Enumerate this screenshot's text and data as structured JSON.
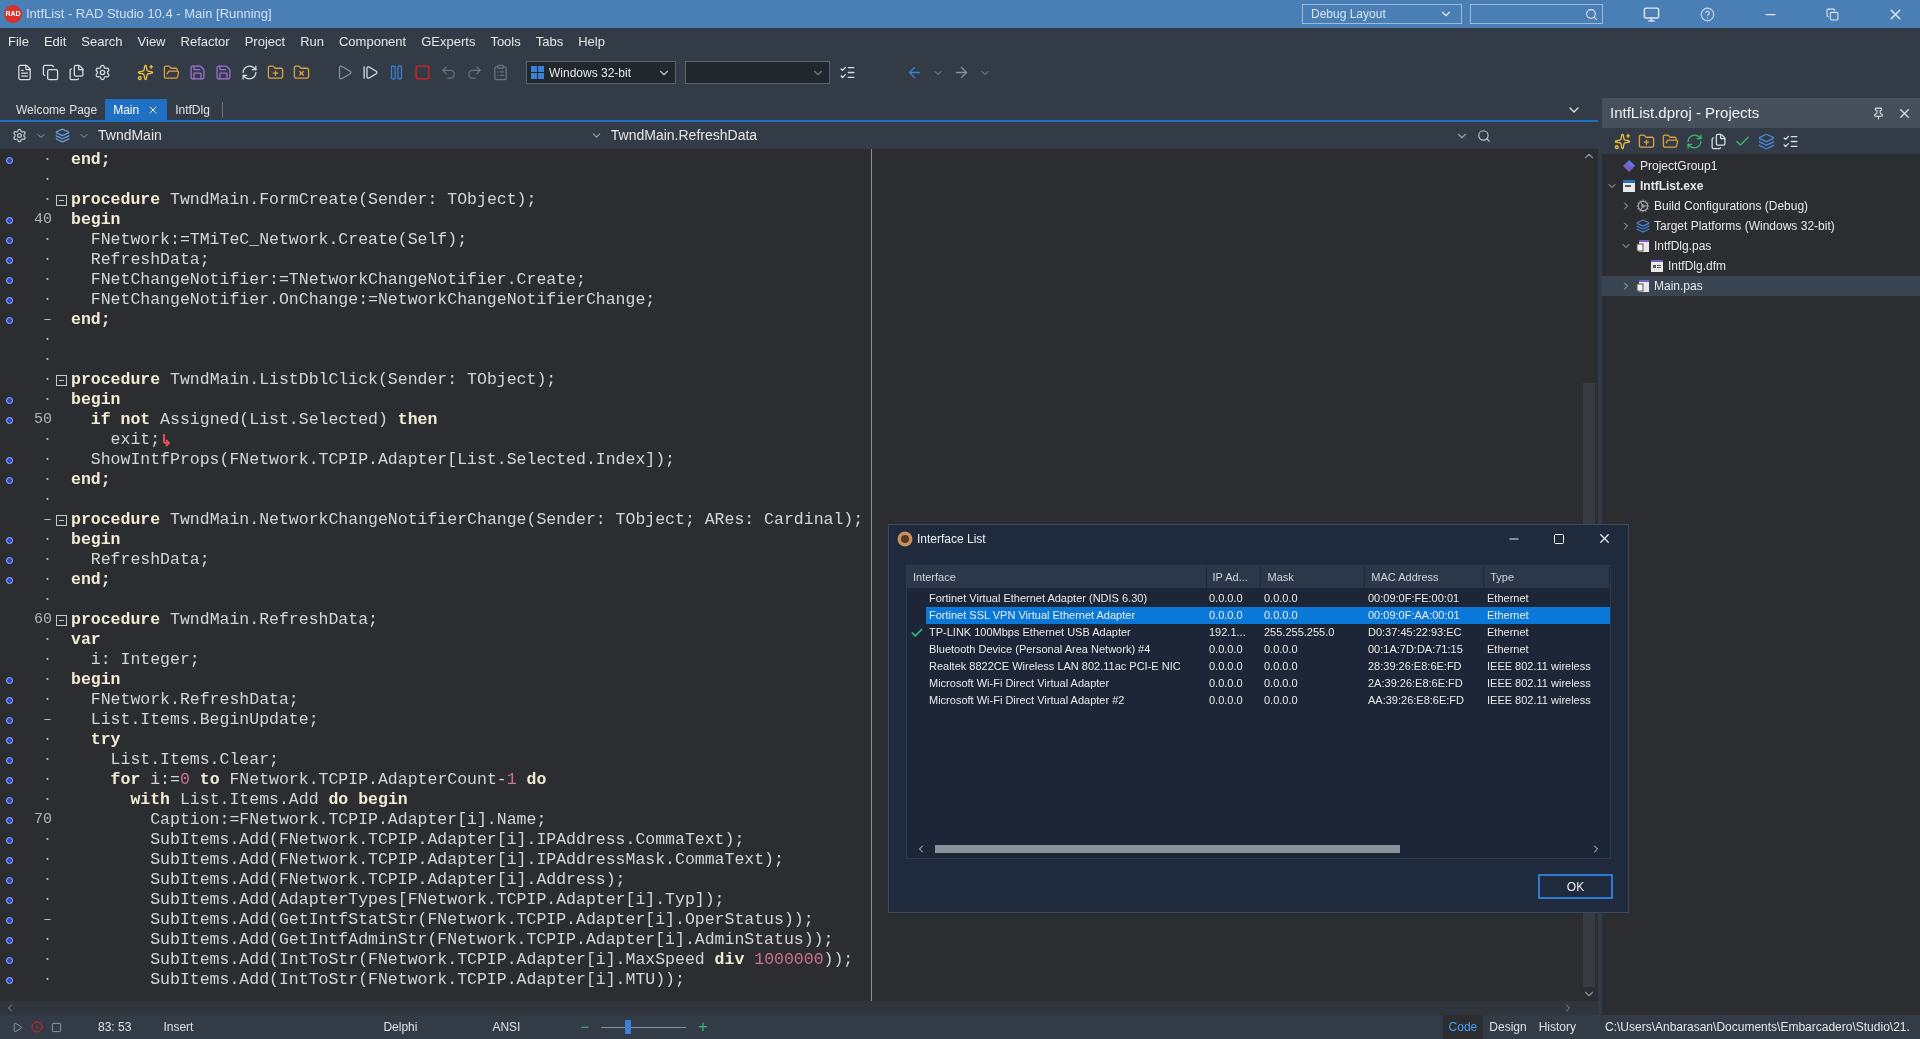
{
  "title_bar": {
    "logo": "RAD",
    "title": "IntfList - RAD Studio 10.4 - Main [Running]",
    "layout": "Debug Layout"
  },
  "menu": [
    "File",
    "Edit",
    "Search",
    "View",
    "Refactor",
    "Project",
    "Run",
    "Component",
    "GExperts",
    "Tools",
    "Tabs",
    "Help"
  ],
  "toolbar": {
    "platform": "Windows 32-bit"
  },
  "editor_tabs": [
    {
      "label": "Welcome Page",
      "selected": false
    },
    {
      "label": "Main",
      "selected": true
    },
    {
      "label": "IntfDlg",
      "selected": false
    }
  ],
  "editor_header": {
    "class": "TwndMain",
    "method": "TwndMain.RefreshData"
  },
  "code_lines": [
    {
      "gutter": "·",
      "marked": true,
      "segments": [
        {
          "text": "end;",
          "kind": "keyword"
        }
      ]
    },
    {
      "gutter": "·",
      "marked": false
    },
    {
      "gutter": "·",
      "marked": false,
      "fold": true,
      "segments": [
        {
          "text": "procedure",
          "kind": "keyword"
        },
        {
          "text": " TwndMain.FormCreate(Sender: TObject);",
          "kind": "plain"
        }
      ]
    },
    {
      "gutter": "40",
      "marked": true,
      "segments": [
        {
          "text": "begin",
          "kind": "keyword"
        }
      ]
    },
    {
      "gutter": "·",
      "marked": true,
      "segments": [
        {
          "text": "  FNetwork:=TMiTeC_Network.Create(Self);",
          "kind": "plain"
        }
      ]
    },
    {
      "gutter": "·",
      "marked": true,
      "segments": [
        {
          "text": "  RefreshData;",
          "kind": "plain"
        }
      ]
    },
    {
      "gutter": "·",
      "marked": true,
      "segments": [
        {
          "text": "  FNetChangeNotifier:=TNetworkChangeNotifier.Create;",
          "kind": "plain"
        }
      ]
    },
    {
      "gutter": "·",
      "marked": true,
      "segments": [
        {
          "text": "  FNetChangeNotifier.OnChange:=NetworkChangeNotifierChange;",
          "kind": "plain"
        }
      ]
    },
    {
      "gutter": "–",
      "marked": true,
      "segments": [
        {
          "text": "end;",
          "kind": "keyword"
        }
      ]
    },
    {
      "gutter": "·",
      "marked": false
    },
    {
      "gutter": "·",
      "marked": false
    },
    {
      "gutter": "·",
      "marked": false,
      "fold": true,
      "segments": [
        {
          "text": "procedure",
          "kind": "keyword"
        },
        {
          "text": " TwndMain.ListDblClick(Sender: TObject);",
          "kind": "plain"
        }
      ]
    },
    {
      "gutter": "·",
      "marked": true,
      "segments": [
        {
          "text": "begin",
          "kind": "keyword"
        }
      ]
    },
    {
      "gutter": "50",
      "marked": true,
      "segments": [
        {
          "text": "  if not",
          "kind": "keyword"
        },
        {
          "text": " Assigned(List.Selected) ",
          "kind": "plain"
        },
        {
          "text": "then",
          "kind": "keyword"
        }
      ]
    },
    {
      "gutter": "·",
      "marked": false,
      "return_arrow": true,
      "segments": [
        {
          "text": "    exit;",
          "kind": "plain"
        }
      ]
    },
    {
      "gutter": "·",
      "marked": true,
      "segments": [
        {
          "text": "  ShowIntfProps(FNetwork.TCPIP.Adapter[List.Selected.Index]);",
          "kind": "plain"
        }
      ]
    },
    {
      "gutter": "·",
      "marked": true,
      "segments": [
        {
          "text": "end;",
          "kind": "keyword"
        }
      ]
    },
    {
      "gutter": "·",
      "marked": false
    },
    {
      "gutter": "–",
      "marked": false,
      "fold": true,
      "segments": [
        {
          "text": "procedure",
          "kind": "keyword"
        },
        {
          "text": " TwndMain.NetworkChangeNotifierChange(Sender: TObject; ARes: Cardinal);",
          "kind": "plain"
        }
      ]
    },
    {
      "gutter": "·",
      "marked": true,
      "segments": [
        {
          "text": "begin",
          "kind": "keyword"
        }
      ]
    },
    {
      "gutter": "·",
      "marked": true,
      "segments": [
        {
          "text": "  RefreshData;",
          "kind": "plain"
        }
      ]
    },
    {
      "gutter": "·",
      "marked": true,
      "segments": [
        {
          "text": "end;",
          "kind": "keyword"
        }
      ]
    },
    {
      "gutter": "·",
      "marked": false
    },
    {
      "gutter": "60",
      "marked": false,
      "fold": true,
      "segments": [
        {
          "text": "procedure",
          "kind": "keyword"
        },
        {
          "text": " TwndMain.RefreshData;",
          "kind": "plain"
        }
      ]
    },
    {
      "gutter": "·",
      "marked": false,
      "segments": [
        {
          "text": "var",
          "kind": "keyword"
        }
      ]
    },
    {
      "gutter": "·",
      "marked": false,
      "segments": [
        {
          "text": "  i: Integer;",
          "kind": "plain"
        }
      ]
    },
    {
      "gutter": "·",
      "marked": true,
      "segments": [
        {
          "text": "begin",
          "kind": "keyword"
        }
      ]
    },
    {
      "gutter": "·",
      "marked": true,
      "segments": [
        {
          "text": "  FNetwork.RefreshData;",
          "kind": "plain"
        }
      ]
    },
    {
      "gutter": "–",
      "marked": true,
      "segments": [
        {
          "text": "  List.Items.BeginUpdate;",
          "kind": "plain"
        }
      ]
    },
    {
      "gutter": "·",
      "marked": true,
      "segments": [
        {
          "text": "  try",
          "kind": "keyword"
        }
      ]
    },
    {
      "gutter": "·",
      "marked": true,
      "segments": [
        {
          "text": "    List.Items.Clear;",
          "kind": "plain"
        }
      ]
    },
    {
      "gutter": "·",
      "marked": true,
      "segments": [
        {
          "text": "    for",
          "kind": "keyword"
        },
        {
          "text": " i:=",
          "kind": "plain"
        },
        {
          "text": "0",
          "kind": "number"
        },
        {
          "text": " to",
          "kind": "keyword"
        },
        {
          "text": " FNetwork.TCPIP.AdapterCount-",
          "kind": "plain"
        },
        {
          "text": "1",
          "kind": "number"
        },
        {
          "text": " do",
          "kind": "keyword"
        }
      ]
    },
    {
      "gutter": "·",
      "marked": true,
      "segments": [
        {
          "text": "      with",
          "kind": "keyword"
        },
        {
          "text": " List.Items.Add ",
          "kind": "plain"
        },
        {
          "text": "do begin",
          "kind": "keyword"
        }
      ]
    },
    {
      "gutter": "70",
      "marked": true,
      "segments": [
        {
          "text": "        Caption:=FNetwork.TCPIP.Adapter[i].Name;",
          "kind": "plain"
        }
      ]
    },
    {
      "gutter": "·",
      "marked": true,
      "segments": [
        {
          "text": "        SubItems.Add(FNetwork.TCPIP.Adapter[i].IPAddress.CommaText);",
          "kind": "plain"
        }
      ]
    },
    {
      "gutter": "·",
      "marked": true,
      "segments": [
        {
          "text": "        SubItems.Add(FNetwork.TCPIP.Adapter[i].IPAddressMask.CommaText);",
          "kind": "plain"
        }
      ]
    },
    {
      "gutter": "·",
      "marked": true,
      "segments": [
        {
          "text": "        SubItems.Add(FNetwork.TCPIP.Adapter[i].Address);",
          "kind": "plain"
        }
      ]
    },
    {
      "gutter": "·",
      "marked": true,
      "segments": [
        {
          "text": "        SubItems.Add(AdapterTypes[FNetwork.TCPIP.Adapter[i].Typ]);",
          "kind": "plain"
        }
      ]
    },
    {
      "gutter": "–",
      "marked": true,
      "segments": [
        {
          "text": "        SubItems.Add(GetIntfStatStr(FNetwork.TCPIP.Adapter[i].OperStatus));",
          "kind": "plain"
        }
      ]
    },
    {
      "gutter": "·",
      "marked": true,
      "segments": [
        {
          "text": "        SubItems.Add(GetIntfAdminStr(FNetwork.TCPIP.Adapter[i].AdminStatus));",
          "kind": "plain"
        }
      ]
    },
    {
      "gutter": "·",
      "marked": true,
      "segments": [
        {
          "text": "        SubItems.Add(IntToStr(FNetwork.TCPIP.Adapter[i].MaxSpeed ",
          "kind": "plain"
        },
        {
          "text": "div",
          "kind": "keyword"
        },
        {
          "text": " 1000000",
          "kind": "number"
        },
        {
          "text": "));",
          "kind": "plain"
        }
      ]
    },
    {
      "gutter": "·",
      "marked": true,
      "segments": [
        {
          "text": "        SubItems.Add(IntToStr(FNetwork.TCPIP.Adapter[i].MTU));",
          "kind": "plain"
        }
      ]
    }
  ],
  "status_bar": {
    "position": "83: 53",
    "mode": "Insert",
    "language": "Delphi",
    "encoding": "ANSI",
    "zoom": {
      "minus": "−",
      "plus": "+",
      "level": 0.31
    },
    "view_tabs": [
      {
        "label": "Code",
        "selected": true
      },
      {
        "label": "Design",
        "selected": false
      },
      {
        "label": "History",
        "selected": false
      }
    ]
  },
  "projects": {
    "title": "IntfList.dproj - Projects",
    "tree": [
      {
        "label": "ProjectGroup1",
        "kind": "group",
        "children": [
          {
            "label": "IntfList.exe",
            "kind": "exe",
            "bold": true,
            "expanded": true,
            "selected": false,
            "children": [
              {
                "label": "Build Configurations (Debug)",
                "kind": "config",
                "expanded": false,
                "selected": false
              },
              {
                "label": "Target Platforms (Windows 32-bit)",
                "kind": "platforms",
                "expanded": false,
                "selected": false
              },
              {
                "label": "IntfDlg.pas",
                "kind": "pas",
                "expanded": true,
                "selected": false,
                "children": [
                  {
                    "label": "IntfDlg.dfm",
                    "kind": "dfm",
                    "selected": false
                  }
                ]
              },
              {
                "label": "Main.pas",
                "kind": "pas",
                "expanded": false,
                "selected": true
              }
            ]
          }
        ]
      }
    ],
    "path": "C:\\Users\\Anbarasan\\Documents\\Embarcadero\\Studio\\21."
  },
  "dialog": {
    "title": "Interface List",
    "columns": [
      "Interface",
      "IP Ad...",
      "Mask",
      "MAC Address",
      "Type"
    ],
    "rows": [
      {
        "cells": [
          "Fortinet Virtual Ethernet Adapter (NDIS 6.30)",
          "0.0.0.0",
          "0.0.0.0",
          "00:09:0F:FE:00:01",
          "Ethernet"
        ],
        "selected": false,
        "checked": false
      },
      {
        "cells": [
          "Fortinet SSL VPN Virtual Ethernet Adapter",
          "0.0.0.0",
          "0.0.0.0",
          "00:09:0F:AA:00:01",
          "Ethernet"
        ],
        "selected": true,
        "checked": false
      },
      {
        "cells": [
          "TP-LINK 100Mbps Ethernet USB Adapter",
          "192.1...",
          "255.255.255.0",
          "D0:37:45:22:93:EC",
          "Ethernet"
        ],
        "selected": false,
        "checked": true
      },
      {
        "cells": [
          "Bluetooth Device (Personal Area Network) #4",
          "0.0.0.0",
          "0.0.0.0",
          "00:1A:7D:DA:71:15",
          "Ethernet"
        ],
        "selected": false,
        "checked": false
      },
      {
        "cells": [
          "Realtek 8822CE Wireless LAN 802.11ac PCI-E NIC",
          "0.0.0.0",
          "0.0.0.0",
          "28:39:26:E8:6E:FD",
          "IEEE 802.11 wireless"
        ],
        "selected": false,
        "checked": false
      },
      {
        "cells": [
          "Microsoft Wi-Fi Direct Virtual Adapter",
          "0.0.0.0",
          "0.0.0.0",
          "2A:39:26:E8:6E:FD",
          "IEEE 802.11 wireless"
        ],
        "selected": false,
        "checked": false
      },
      {
        "cells": [
          "Microsoft Wi-Fi Direct Virtual Adapter #2",
          "0.0.0.0",
          "0.0.0.0",
          "AA:39:26:E8:6E:FD",
          "IEEE 802.11 wireless"
        ],
        "selected": false,
        "checked": false
      }
    ],
    "ok": "OK"
  }
}
